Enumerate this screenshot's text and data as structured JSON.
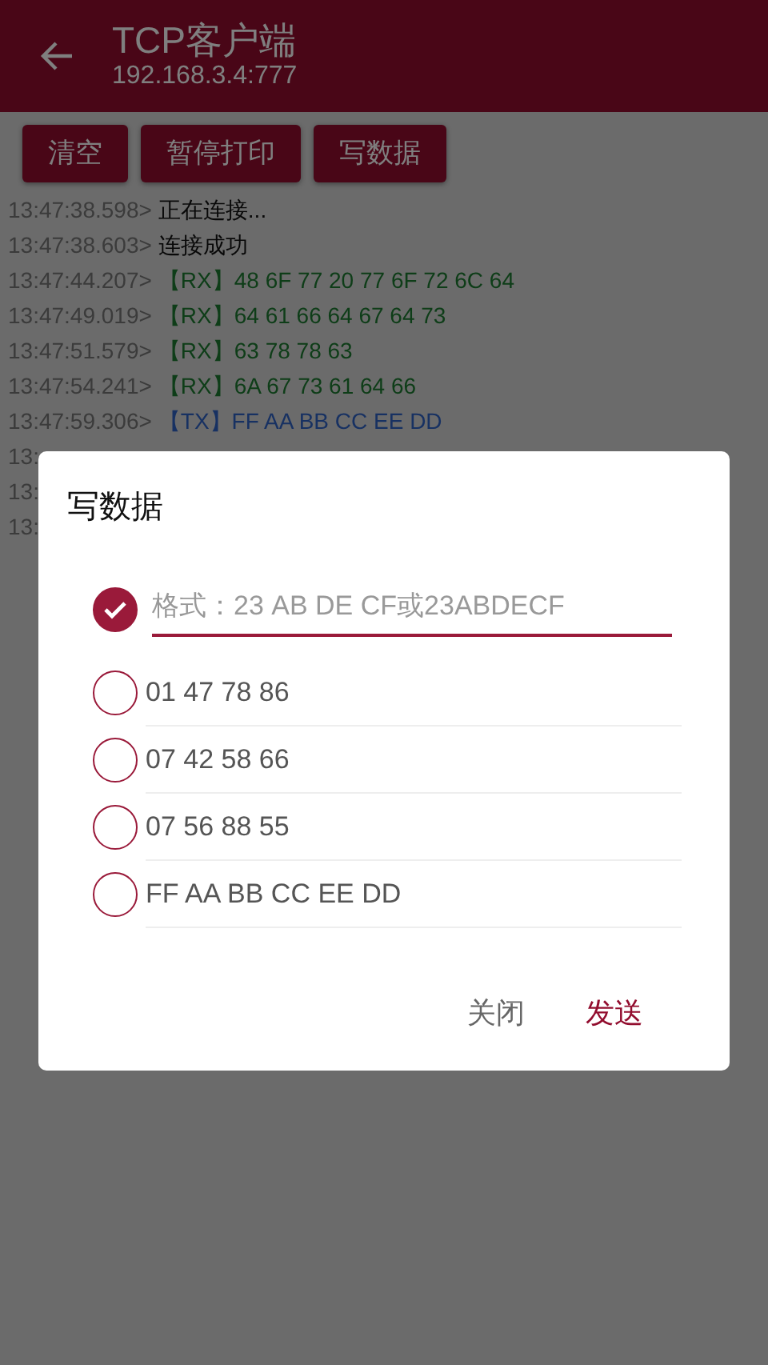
{
  "header": {
    "title": "TCP客户端",
    "subtitle": "192.168.3.4:777"
  },
  "toolbar": [
    "清空",
    "暂停打印",
    "写数据"
  ],
  "log": [
    {
      "time": "13:47:38.598>",
      "kind": "status",
      "text": "正在连接..."
    },
    {
      "time": "13:47:38.603>",
      "kind": "status",
      "text": "连接成功"
    },
    {
      "time": "13:47:44.207>",
      "kind": "rx",
      "text": "【RX】48 6F 77 20 77 6F 72 6C 64"
    },
    {
      "time": "13:47:49.019>",
      "kind": "rx",
      "text": "【RX】64 61 66 64 67 64 73"
    },
    {
      "time": "13:47:51.579>",
      "kind": "rx",
      "text": "【RX】63 78 78 63"
    },
    {
      "time": "13:47:54.241>",
      "kind": "rx",
      "text": "【RX】6A 67 73 61 64 66"
    },
    {
      "time": "13:47:59.306>",
      "kind": "tx",
      "text": "【TX】FF AA BB CC EE DD"
    },
    {
      "time": "13:"
    },
    {
      "time": "13:"
    },
    {
      "time": "13:"
    }
  ],
  "dialog": {
    "title": "写数据",
    "options": [
      {
        "kind": "input",
        "placeholder": "格式：23 AB DE CF或23ABDECF",
        "selected": true
      },
      {
        "kind": "preset",
        "label": "01 47 78 86",
        "selected": false
      },
      {
        "kind": "preset",
        "label": "07 42 58 66",
        "selected": false
      },
      {
        "kind": "preset",
        "label": "07 56 88 55",
        "selected": false
      },
      {
        "kind": "preset",
        "label": "FF AA BB CC EE DD",
        "selected": false
      }
    ],
    "buttons": [
      {
        "label": "关闭",
        "kind": "secondary"
      },
      {
        "label": "发送",
        "kind": "primary"
      }
    ]
  }
}
